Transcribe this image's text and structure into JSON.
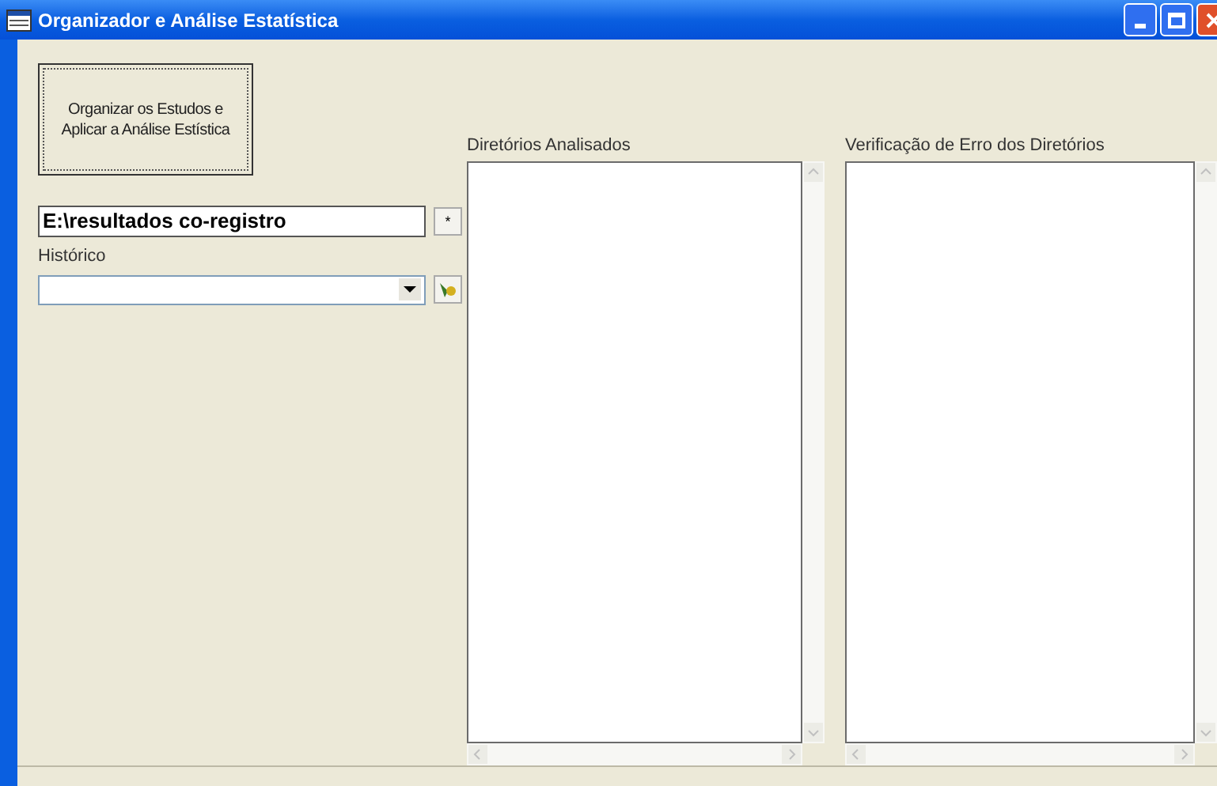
{
  "window": {
    "title": "Organizador e Análise Estatística"
  },
  "organize_button": {
    "label": "Organizar os Estudos e Aplicar a Análise Estística"
  },
  "path_field": {
    "value": "E:\\resultados co-registro"
  },
  "browse_button": {
    "label": "*"
  },
  "history": {
    "label": "Histórico"
  },
  "lists": [
    {
      "label": "Diretórios Analisados"
    },
    {
      "label": "Verificação de Erro dos Diretórios"
    }
  ]
}
